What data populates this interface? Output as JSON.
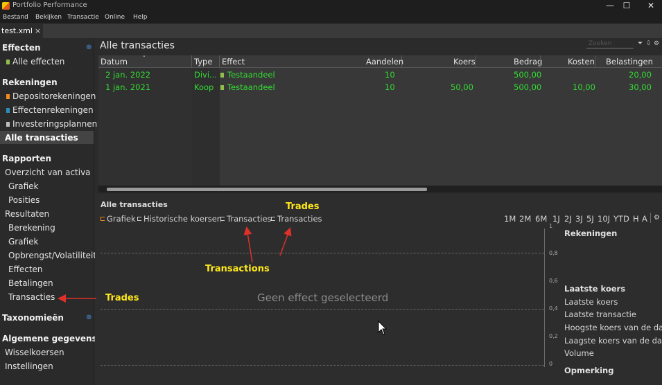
{
  "window": {
    "title": "Portfolio Performance",
    "minimize_glyph": "—",
    "maximize_glyph": "☐",
    "close_glyph": "✕"
  },
  "menubar": [
    "Bestand",
    "Bekijken",
    "Transactie",
    "Online",
    "Help"
  ],
  "file_tab": {
    "label": "test.xml",
    "close_glyph": "×"
  },
  "sidebar": {
    "sections": [
      {
        "title": "Effecten",
        "items": [
          {
            "label": "Alle effecten",
            "icon_color": "#8fbf4a"
          }
        ]
      },
      {
        "title": "Rekeningen",
        "items": [
          {
            "label": "Depositorekeningen",
            "icon_color": "#f28c1e"
          },
          {
            "label": "Effectenrekeningen",
            "icon_color": "#2a8fb8"
          },
          {
            "label": "Investeringsplannen",
            "icon_color": "#bdbdbd"
          },
          {
            "label": "Alle transacties",
            "selected": true
          }
        ]
      },
      {
        "title": "Rapporten",
        "items": [
          {
            "label": "Overzicht van activa"
          },
          {
            "label": "Grafiek"
          },
          {
            "label": "Posities"
          },
          {
            "label": "Resultaten"
          },
          {
            "label": "Berekening"
          },
          {
            "label": "Grafiek"
          },
          {
            "label": "Opbrengst/Volatiliteit"
          },
          {
            "label": "Effecten"
          },
          {
            "label": "Betalingen"
          },
          {
            "label": "Transacties"
          }
        ]
      },
      {
        "title": "Taxonomieën"
      },
      {
        "title": "Algemene gegevens",
        "items": [
          {
            "label": "Wisselkoersen"
          },
          {
            "label": "Instellingen"
          }
        ]
      }
    ]
  },
  "main": {
    "title": "Alle transacties",
    "search_placeholder": "Zoeken",
    "table": {
      "columns": [
        "Datum",
        "Type",
        "Effect",
        "Aandelen",
        "Koers",
        "Bedrag",
        "Kosten",
        "Belastingen"
      ],
      "rows": [
        {
          "datum": "2 jan. 2022",
          "type": "Divi...",
          "effect": "Testaandeel",
          "aandelen": "10",
          "koers": "",
          "bedrag": "500,00",
          "kosten": "",
          "belastingen": "20,00"
        },
        {
          "datum": "1 jan. 2021",
          "type": "Koop",
          "effect": "Testaandeel",
          "aandelen": "10",
          "koers": "50,00",
          "bedrag": "500,00",
          "kosten": "10,00",
          "belastingen": "30,00"
        }
      ],
      "row_text_color": "#33dd33"
    }
  },
  "detail": {
    "title": "Alle transacties",
    "tabs": [
      "Grafiek",
      "Historische koersen",
      "Transacties",
      "Transacties"
    ],
    "ranges": [
      "1M",
      "2M",
      "6M",
      "1J",
      "2J",
      "3J",
      "5J",
      "10J",
      "YTD",
      "H",
      "A"
    ],
    "y_ticks": [
      "1",
      "0,8",
      "0,6",
      "0,4",
      "0,2",
      "0"
    ],
    "empty_message": "Geen effect geselecteerd",
    "info": {
      "rekeningen_title": "Rekeningen",
      "laatste_koers_title": "Laatste koers",
      "rows": [
        "Laatste koers",
        "Laatste transactie",
        "Hoogste koers van de dag",
        "Laagste koers van de dag",
        "Volume"
      ],
      "opmerking_title": "Opmerking"
    }
  },
  "annotations": {
    "trades_top": "Trades",
    "transactions": "Transactions",
    "trades_left": "Trades",
    "color": "#ffe81a",
    "arrow_color": "#e0302a"
  }
}
